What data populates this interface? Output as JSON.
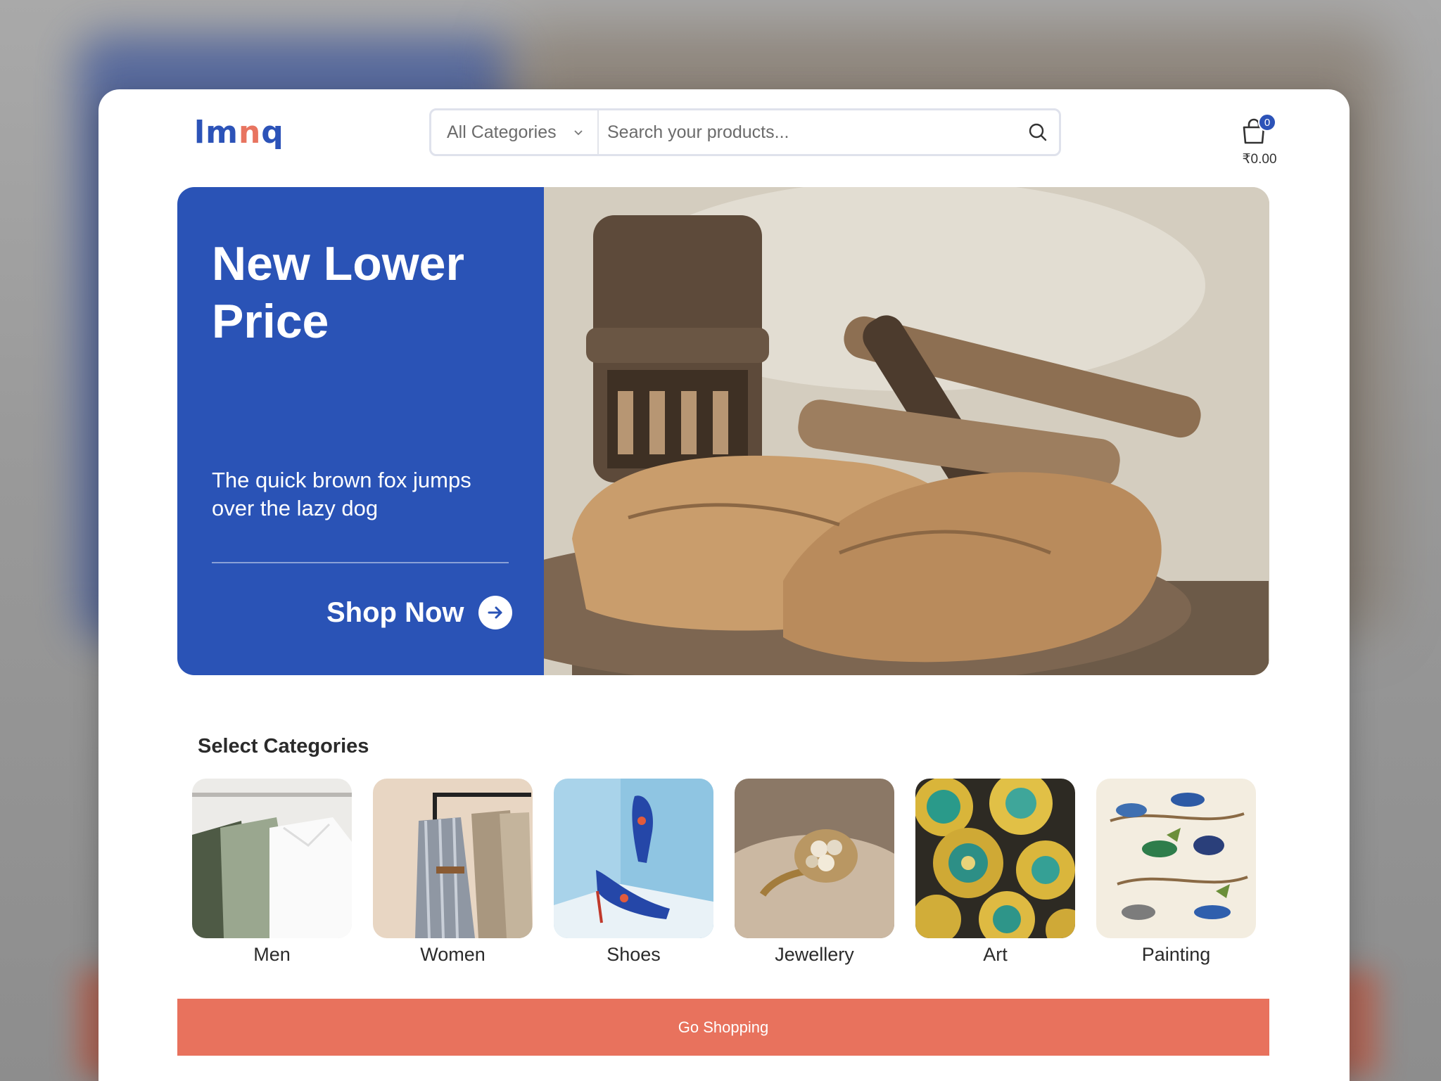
{
  "header": {
    "logo": {
      "left": "lm",
      "mid": "n",
      "right": "q"
    },
    "category_select": "All Categories",
    "search_placeholder": "Search your products...",
    "cart_count": "0",
    "cart_total": "₹0.00"
  },
  "hero": {
    "title": "New Lower Price",
    "subtitle": "The quick brown fox jumps over the lazy dog",
    "cta": "Shop Now"
  },
  "categories": {
    "heading": "Select Categories",
    "items": [
      {
        "label": "Men"
      },
      {
        "label": "Women"
      },
      {
        "label": "Shoes"
      },
      {
        "label": "Jewellery"
      },
      {
        "label": "Art"
      },
      {
        "label": "Painting"
      }
    ]
  },
  "footer_cta": "Go Shopping",
  "colors": {
    "primary": "#2a53b6",
    "accent": "#e8725d"
  }
}
